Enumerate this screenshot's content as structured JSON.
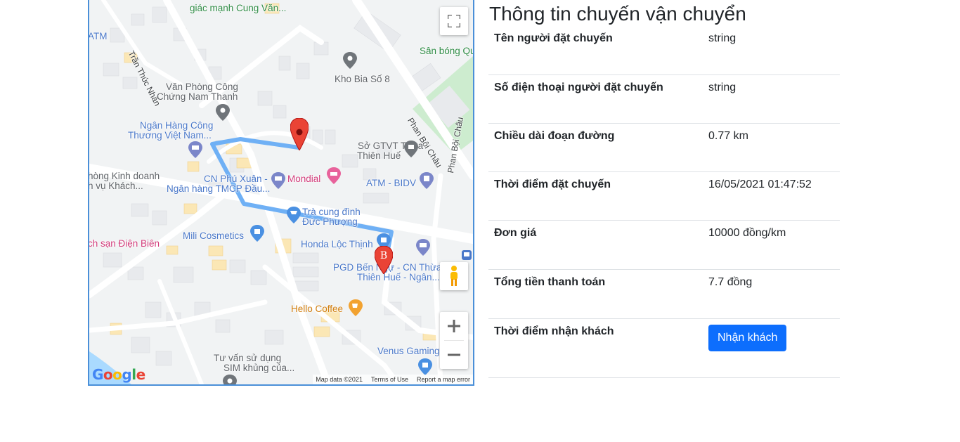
{
  "map": {
    "labels": {
      "l1": "giác mạnh Cung Văn...",
      "l2": "ATM",
      "l3": "Trần Thúc Nhẫn",
      "l4": "Sân bóng Qu",
      "l5": "Kho Bia Số 8",
      "l6a": "Văn Phòng Công",
      "l6b": "Chứng Nam Thanh",
      "l7a": "Ngân Hàng Công",
      "l7b": "Thương Việt Nam...",
      "l8": "Phan Bội Châu",
      "l9a": "Sở GTVT Thừa",
      "l9b": "Thiên Huế",
      "l10a": "hòng Kinh doanh",
      "l10b": "h vụ Khách...",
      "l11a": "CN Phú Xuân -",
      "l11b": "Ngân hàng TMCP Đầu...",
      "l12": "Mondial",
      "l13": "ATM - BIDV",
      "l14": "Phan Bội Châu",
      "l15a": "Trà cung đình",
      "l15b": "Đức Phượng",
      "l16": "Mili Cosmetics",
      "l17": "ch sạn Điện Biên",
      "l18": "Honda Lộc Thịnh",
      "l19a": "PGD Bến Ngự - CN Thừa",
      "l19b": "Thiên Huế - Ngân...",
      "l20": "Hello Coffee",
      "l21": "Venus Gaming",
      "l22a": "Tư vấn sử dụng",
      "l22b": "SIM khủng của..."
    },
    "marker_b_letter": "B",
    "google_logo": "Google",
    "footer": {
      "map_data": "Map data ©2021",
      "terms": "Terms of Use",
      "report": "Report a map error"
    },
    "icons": {
      "fullscreen": "fullscreen-icon",
      "pegman": "pegman-icon",
      "zoom_in": "plus-icon",
      "zoom_out": "minus-icon"
    },
    "colors": {
      "route": "#6fb0f5",
      "marker": "#ea4335"
    }
  },
  "info": {
    "title": "Thông tin chuyến vận chuyển",
    "rows": [
      {
        "label": "Tên người đặt chuyến",
        "value": "string"
      },
      {
        "label": "Số điện thoại người đặt chuyến",
        "value": "string"
      },
      {
        "label": "Chiều dài đoạn đường",
        "value": "0.77 km"
      },
      {
        "label": "Thời điểm đặt chuyến",
        "value": "16/05/2021 01:47:52"
      },
      {
        "label": "Đơn giá",
        "value": "10000 đồng/km"
      },
      {
        "label": "Tổng tiền thanh toán",
        "value": "7.7 đồng"
      },
      {
        "label": "Thời điểm nhận khách",
        "button": "Nhận khách"
      }
    ],
    "colors": {
      "button": "#0d6efd"
    }
  }
}
